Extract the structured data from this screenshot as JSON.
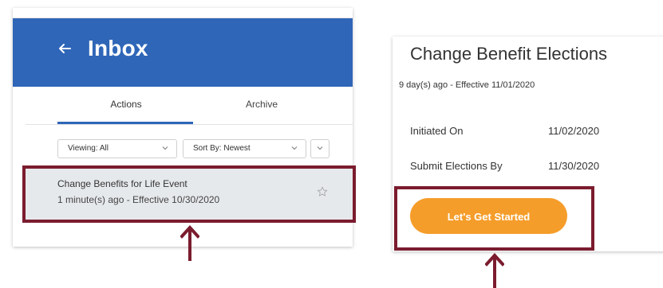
{
  "inbox": {
    "title": "Inbox",
    "tabs": [
      {
        "label": "Actions",
        "active": true
      },
      {
        "label": "Archive",
        "active": false
      }
    ],
    "filters": {
      "viewing_label": "Viewing: All",
      "sort_label": "Sort By: Newest"
    },
    "items": [
      {
        "title": "Change Benefits for Life Event",
        "subtitle": "1 minute(s) ago - Effective 10/30/2020"
      }
    ],
    "header_color": "#2f66b8"
  },
  "elections": {
    "title": "Change Benefit Elections",
    "subtitle": "9 day(s) ago - Effective 11/01/2020",
    "fields": [
      {
        "label": "Initiated On",
        "value": "11/02/2020"
      },
      {
        "label": "Submit Elections By",
        "value": "11/30/2020"
      }
    ],
    "start_button_label": "Let's Get Started",
    "button_color": "#f59d2a"
  },
  "annotations": {
    "highlight_color": "#7b1c2e"
  },
  "icons": [
    "back-arrow-icon",
    "chevron-down-icon",
    "star-icon",
    "up-arrow-icon"
  ]
}
